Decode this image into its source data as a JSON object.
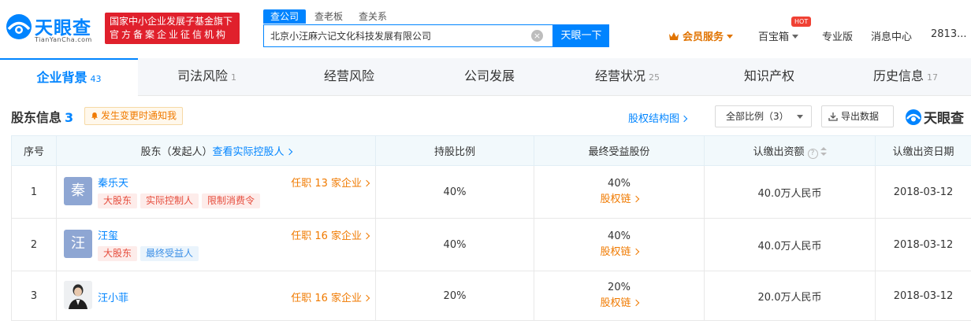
{
  "header": {
    "logo_text": "天眼查",
    "logo_sub": "TianYanCha.com",
    "badge_line1": "国家中小企业发展子基金旗下",
    "badge_line2": "官方备案企业征信机构",
    "search_tabs": [
      "查公司",
      "查老板",
      "查关系"
    ],
    "search_value": "北京小汪麻六记文化科技发展有限公司",
    "search_button": "天眼一下",
    "member": "会员服务",
    "baoxiang": "百宝箱",
    "hot": "HOT",
    "pro": "专业版",
    "messages": "消息中心",
    "user": "2813..."
  },
  "nav": [
    {
      "label": "企业背景",
      "count": "43"
    },
    {
      "label": "司法风险",
      "count": "1"
    },
    {
      "label": "经营风险",
      "count": ""
    },
    {
      "label": "公司发展",
      "count": ""
    },
    {
      "label": "经营状况",
      "count": "25"
    },
    {
      "label": "知识产权",
      "count": ""
    },
    {
      "label": "历史信息",
      "count": "17"
    }
  ],
  "section": {
    "title": "股东信息",
    "count": "3",
    "notify": "发生变更时通知我",
    "equity_link": "股权结构图",
    "ratio_select": "全部比例（3）",
    "export": "导出数据",
    "watermark": "天眼查"
  },
  "table": {
    "headers": {
      "no": "序号",
      "holder": "股东（发起人）",
      "holder_link": "查看实际控股人",
      "ratio": "持股比例",
      "final": "最终受益股份",
      "capital": "认缴出资额",
      "date": "认缴出资日期"
    },
    "chain_label": "股权链",
    "rows": [
      {
        "no": "1",
        "avatar": "秦",
        "name": "秦乐天",
        "office": "任职 13 家企业",
        "tags": [
          "大股东",
          "实际控制人",
          "限制消费令"
        ],
        "ratio": "40%",
        "final": "40%",
        "capital": "40.0万人民币",
        "date": "2018-03-12"
      },
      {
        "no": "2",
        "avatar": "汪",
        "name": "汪玺",
        "office": "任职 16 家企业",
        "tags": [
          "大股东",
          "最终受益人"
        ],
        "ratio": "40%",
        "final": "40%",
        "capital": "40.0万人民币",
        "date": "2018-03-12"
      },
      {
        "no": "3",
        "avatar": "",
        "name": "汪小菲",
        "office": "任职 16 家企业",
        "tags": [],
        "ratio": "20%",
        "final": "20%",
        "capital": "20.0万人民币",
        "date": "2018-03-12"
      }
    ]
  }
}
